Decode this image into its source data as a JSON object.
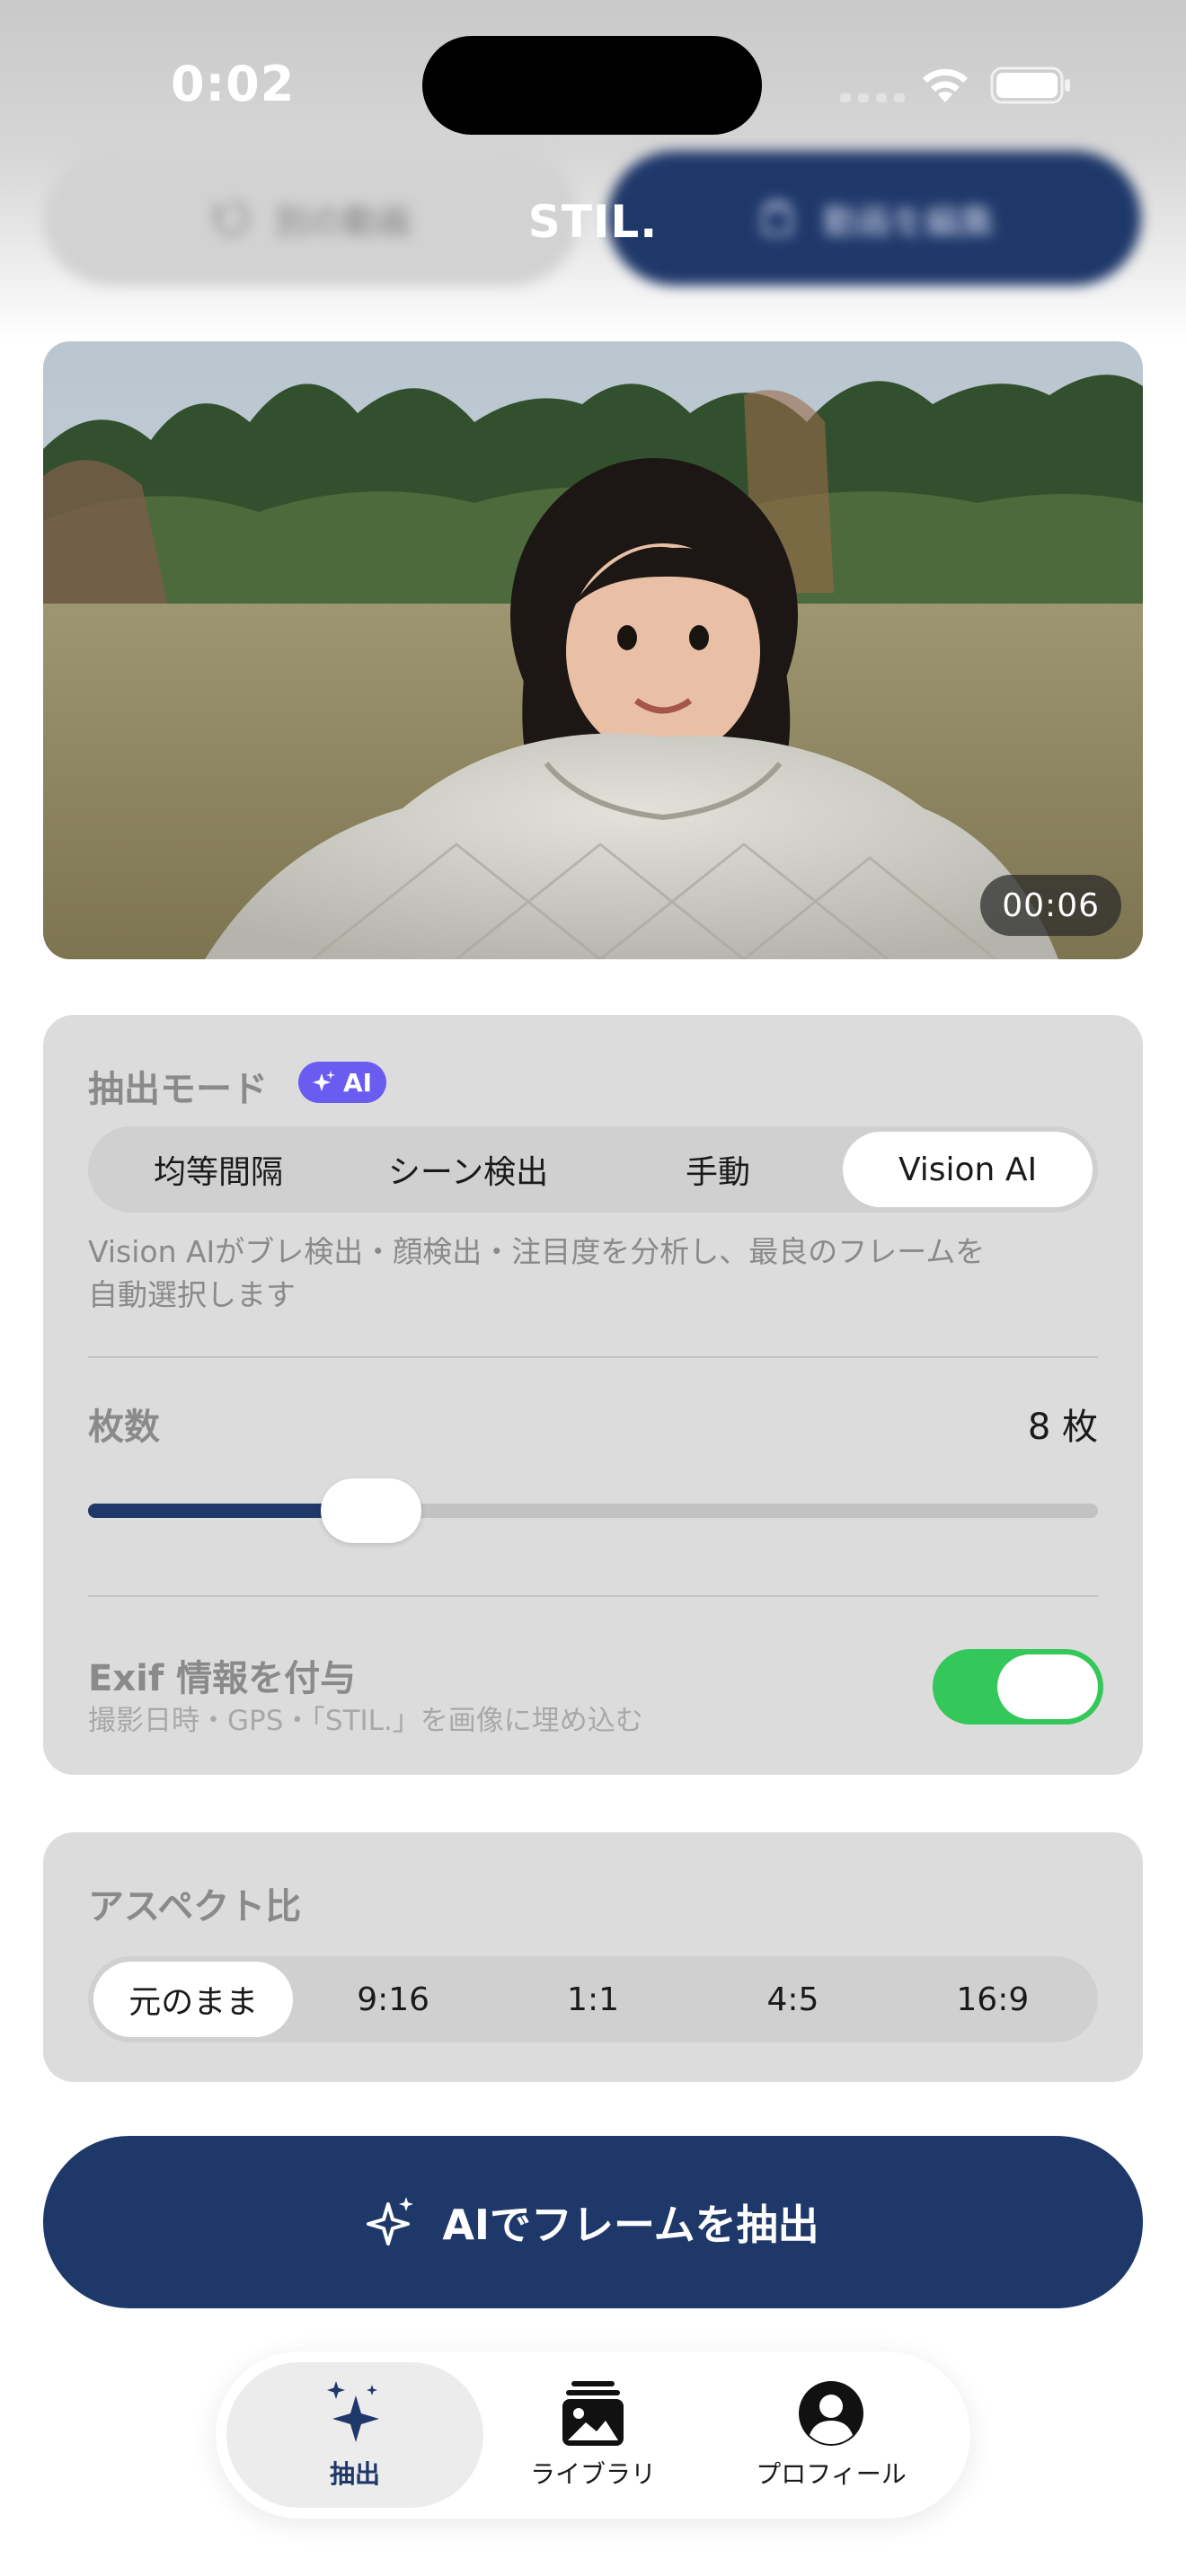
{
  "status_bar": {
    "time": "0:02"
  },
  "header": {
    "title": "STIL.",
    "other_video_label": "別の動画",
    "edit_video_label": "動画を編集"
  },
  "video": {
    "duration": "00:06"
  },
  "mode": {
    "label": "抽出モード",
    "ai_badge": "AI",
    "options": [
      "均等間隔",
      "シーン検出",
      "手動",
      "Vision AI"
    ],
    "selected": "Vision AI",
    "description_line1": "Vision AIがブレ検出・顔検出・注目度を分析し、最良のフレームを",
    "description_line2": "自動選択します"
  },
  "count": {
    "label": "枚数",
    "value_text": "8 枚",
    "slider_fraction": 0.28
  },
  "exif": {
    "label": "Exif 情報を付与",
    "sublabel": "撮影日時・GPS・「STIL.」を画像に埋め込む",
    "enabled": true
  },
  "aspect": {
    "label": "アスペクト比",
    "options": [
      "元のまま",
      "9:16",
      "1:1",
      "4:5",
      "16:9"
    ],
    "selected": "元のまま"
  },
  "extract_button": {
    "label": "AIでフレームを抽出"
  },
  "tabbar": {
    "items": [
      {
        "label": "抽出",
        "icon": "sparkles-icon",
        "active": true
      },
      {
        "label": "ライブラリ",
        "icon": "photo-library-icon",
        "active": false
      },
      {
        "label": "プロフィール",
        "icon": "person-circle-icon",
        "active": false
      }
    ]
  },
  "colors": {
    "navy": "#1f386a",
    "toggle_on": "#34c759",
    "ai_badge": "#6a5cf0",
    "card_bg": "#dcdcdc"
  }
}
